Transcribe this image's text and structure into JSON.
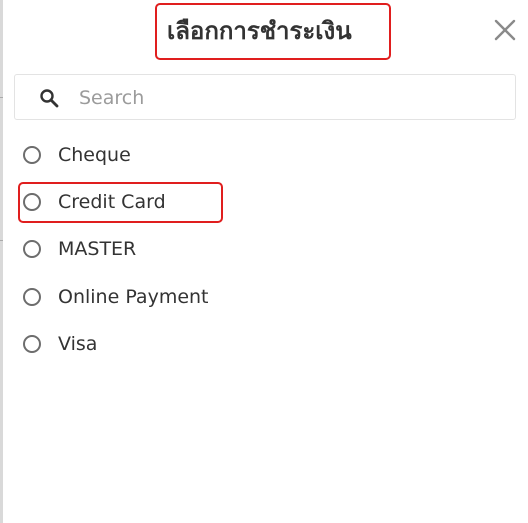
{
  "dialog": {
    "title": "เลือกการชำระเงิน",
    "close_icon": "close-icon"
  },
  "search": {
    "placeholder": "Search",
    "value": "",
    "icon": "search-icon"
  },
  "payment_options": [
    {
      "label": "Cheque",
      "selected": false
    },
    {
      "label": "Credit Card",
      "selected": false
    },
    {
      "label": "MASTER",
      "selected": false
    },
    {
      "label": "Online Payment",
      "selected": false
    },
    {
      "label": "Visa",
      "selected": false
    }
  ],
  "highlight_color": "#e01e1e"
}
